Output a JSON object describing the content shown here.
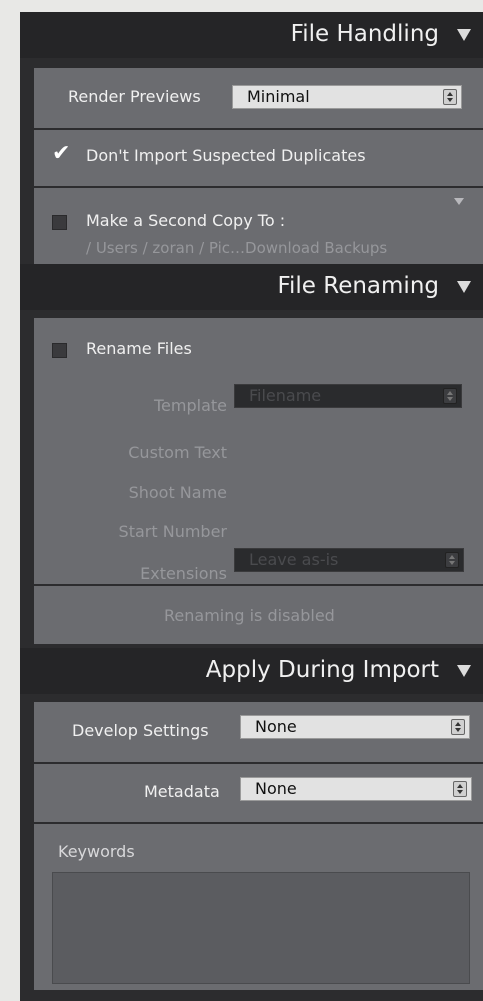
{
  "file_handling": {
    "title": "File Handling",
    "render_previews_label": "Render Previews",
    "render_previews_value": "Minimal",
    "dont_import_duplicates_label": "Don't Import Suspected Duplicates",
    "dont_import_duplicates_checked": true,
    "second_copy_label": "Make a Second Copy To :",
    "second_copy_checked": false,
    "second_copy_path": "/ Users / zoran / Pic…Download Backups"
  },
  "file_renaming": {
    "title": "File Renaming",
    "rename_files_label": "Rename Files",
    "rename_files_checked": false,
    "template_label": "Template",
    "template_value": "Filename",
    "custom_text_label": "Custom Text",
    "shoot_name_label": "Shoot Name",
    "start_number_label": "Start Number",
    "extensions_label": "Extensions",
    "extensions_value": "Leave as-is",
    "status": "Renaming is disabled"
  },
  "apply_during_import": {
    "title": "Apply During Import",
    "develop_settings_label": "Develop Settings",
    "develop_settings_value": "None",
    "metadata_label": "Metadata",
    "metadata_value": "None",
    "keywords_label": "Keywords",
    "keywords_value": ""
  }
}
